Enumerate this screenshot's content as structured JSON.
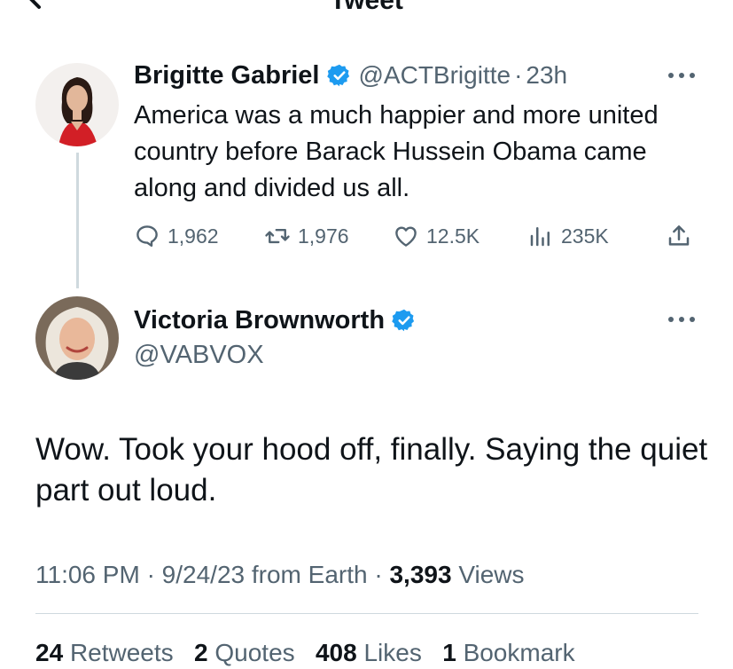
{
  "header": {
    "title": "Tweet",
    "back_icon": "arrow-left-icon"
  },
  "parent_tweet": {
    "author_name": "Brigitte Gabriel",
    "handle": "@ACTBrigitte",
    "separator": "·",
    "time": "23h",
    "text": "America was a much happier and more united country before Barack Hussein Obama came along and divided us all.",
    "replies": "1,962",
    "retweets": "1,976",
    "likes": "12.5K",
    "views": "235K"
  },
  "main_tweet": {
    "author_name": "Victoria Brownworth",
    "handle": "@VABVOX",
    "text": "Wow. Took your hood off, finally. Saying the quiet part out loud.",
    "time": "11:06 PM",
    "sep1": "·",
    "date": "9/24/23",
    "source": "from Earth",
    "sep2": "·",
    "views_count": "3,393",
    "views_label": "Views",
    "retweets_count": "24",
    "retweets_label": "Retweets",
    "quotes_count": "2",
    "quotes_label": "Quotes",
    "likes_count": "408",
    "likes_label": "Likes",
    "bookmarks_count": "1",
    "bookmarks_label": "Bookmark"
  },
  "colors": {
    "text": "#0f1419",
    "secondary": "#536471",
    "verified": "#1d9bf0",
    "divider": "#cfd9de"
  }
}
